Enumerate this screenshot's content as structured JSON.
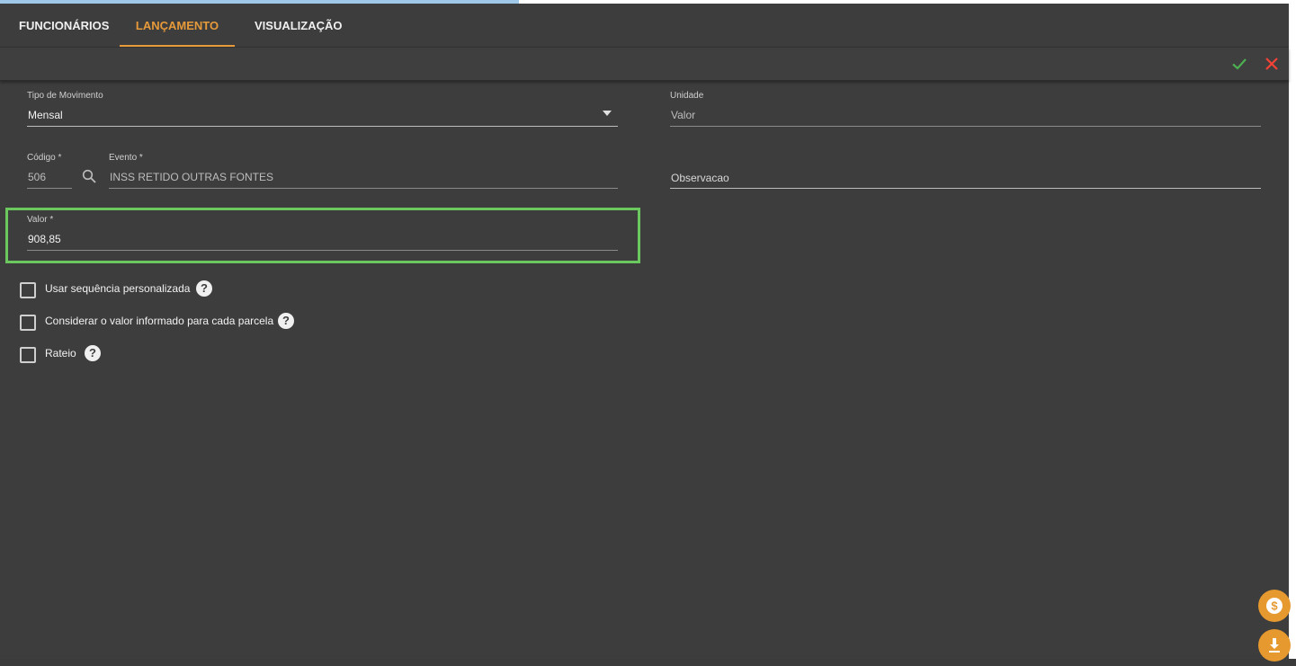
{
  "tabs": [
    {
      "label": "FUNCIONÁRIOS",
      "active": false
    },
    {
      "label": "LANÇAMENTO",
      "active": true
    },
    {
      "label": "VISUALIZAÇÃO",
      "active": false
    }
  ],
  "toolbar": {
    "confirm_icon": "check-icon",
    "cancel_icon": "close-icon",
    "confirm_color": "#4caf50",
    "cancel_color": "#f44336"
  },
  "form": {
    "tipo_movimento": {
      "label": "Tipo de Movimento",
      "value": "Mensal"
    },
    "unidade": {
      "label": "Unidade",
      "value": "Valor"
    },
    "codigo": {
      "label": "Código *",
      "value": "506"
    },
    "evento": {
      "label": "Evento *",
      "value": "INSS RETIDO OUTRAS FONTES"
    },
    "observacao": {
      "placeholder": "Observacao"
    },
    "valor": {
      "label": "Valor *",
      "value": "908,85"
    }
  },
  "checkboxes": [
    {
      "label": "Usar sequência personalizada",
      "checked": false
    },
    {
      "label": "Considerar o valor informado para cada parcela",
      "checked": false
    },
    {
      "label": "Rateio",
      "checked": false
    }
  ],
  "help_glyph": "?",
  "fabs": [
    {
      "icon": "dollar-icon"
    },
    {
      "icon": "download-icon"
    }
  ],
  "colors": {
    "accent": "#e79a3a",
    "highlight": "#6ac85f",
    "background": "#3d3d3d"
  }
}
